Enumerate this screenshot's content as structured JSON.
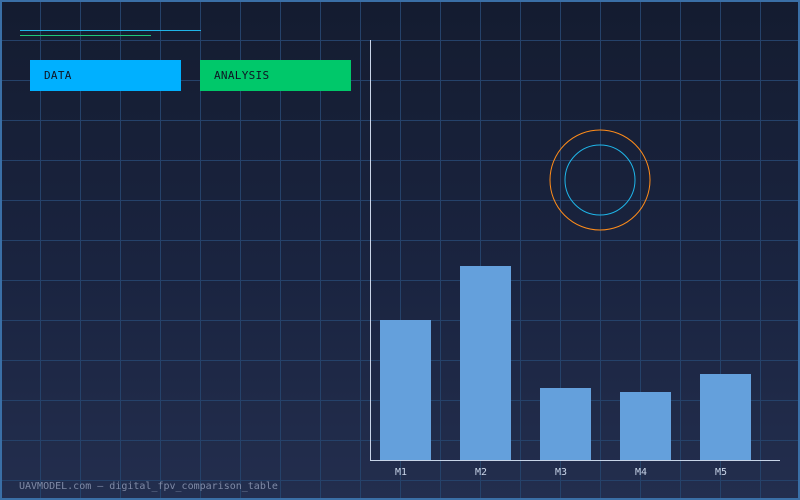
{
  "tags": {
    "data_label": "DATA",
    "analysis_label": "ANALYSIS"
  },
  "footer": "UAVMODEL.com — digital_fpv_comparison_table",
  "colors": {
    "background": "#1a2440",
    "grid": "#25426a",
    "bar": "#64a0dc",
    "tag_data": "#00b0ff",
    "tag_analysis": "#00c86a",
    "ring_outer": "#ff8c1a",
    "ring_inner": "#1fb5e8",
    "axis": "#c8d4e8"
  },
  "chart_data": {
    "type": "bar",
    "categories": [
      "M1",
      "M2",
      "M3",
      "M4",
      "M5"
    ],
    "values": [
      35,
      48.5,
      18,
      17,
      21.5
    ],
    "ylim": [
      0,
      105
    ],
    "grid": true,
    "title": "",
    "xlabel": "",
    "ylabel": ""
  }
}
